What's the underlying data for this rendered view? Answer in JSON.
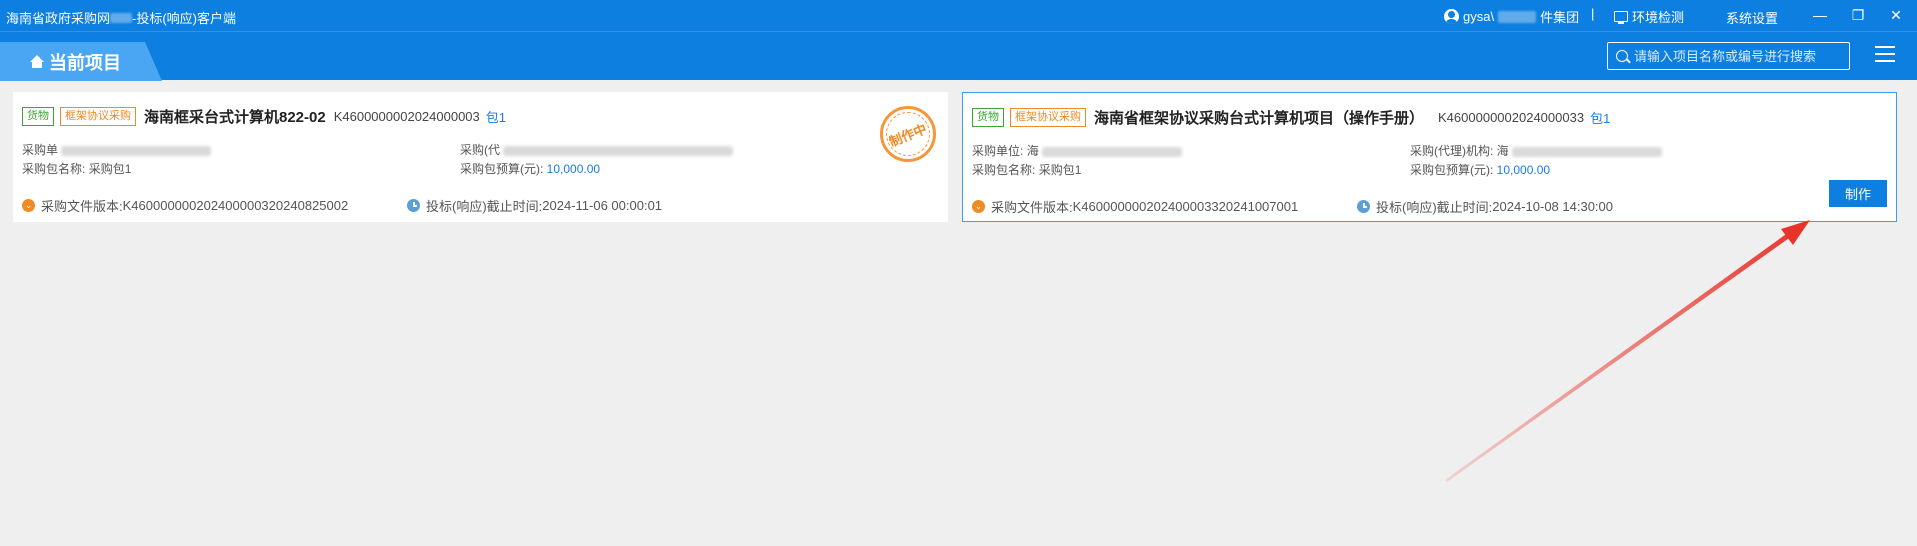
{
  "window": {
    "title": "海南省政府采购网上交易-投标(响应)客户端",
    "title_prefix": "海南省政府采购网",
    "title_suffix": "-投标(响应)客户端",
    "user_prefix": "gysa\\",
    "user_suffix": "件集团",
    "separator": "|",
    "env_check": "环境检测",
    "settings": "系统设置",
    "minimize": "—",
    "restore": "❐",
    "close": "✕"
  },
  "header": {
    "current_tab": "当前项目",
    "search_placeholder": "请输入项目名称或编号进行搜索"
  },
  "projects": [
    {
      "tag_goods": "货物",
      "tag_method": "框架协议采购",
      "name": "海南框采台式计算机822-02",
      "code": "K4600000002024000003",
      "package_link": "包1",
      "purchaser_label": "采购单",
      "agency_label": "采购(代",
      "package_name_label": "采购包名称:",
      "package_name": "采购包1",
      "budget_label": "采购包预算(元):",
      "budget": "10,000.00",
      "file_version_label": "采购文件版本:",
      "file_version": "K460000000202400000320240825002",
      "deadline_label": "投标(响应)截止时间:",
      "deadline": "2024-11-06 00:00:01",
      "stamp": "制作中",
      "status_color": "#f08a24"
    },
    {
      "tag_goods": "货物",
      "tag_method": "框架协议采购",
      "name": "海南省框架协议采购台式计算机项目（操作手册）",
      "code": "K4600000002024000033",
      "package_link": "包1",
      "purchaser_label": "采购单位:",
      "purchaser_prefix": "海",
      "agency_label": "采购(代理)机构:",
      "agency_prefix": "海",
      "package_name_label": "采购包名称:",
      "package_name": "采购包1",
      "budget_label": "采购包预算(元):",
      "budget": "10,000.00",
      "file_version_label": "采购文件版本:",
      "file_version": "K460000000202400003320241007001",
      "deadline_label": "投标(响应)截止时间:",
      "deadline": "2024-10-08 14:30:00",
      "action_button": "制作"
    }
  ],
  "colors": {
    "brand_blue": "#0d7fe0",
    "tab_blue": "#4aa6f2",
    "accent_orange": "#f08a24",
    "accent_green": "#3aa532",
    "arrow_red": "#e8332a"
  }
}
